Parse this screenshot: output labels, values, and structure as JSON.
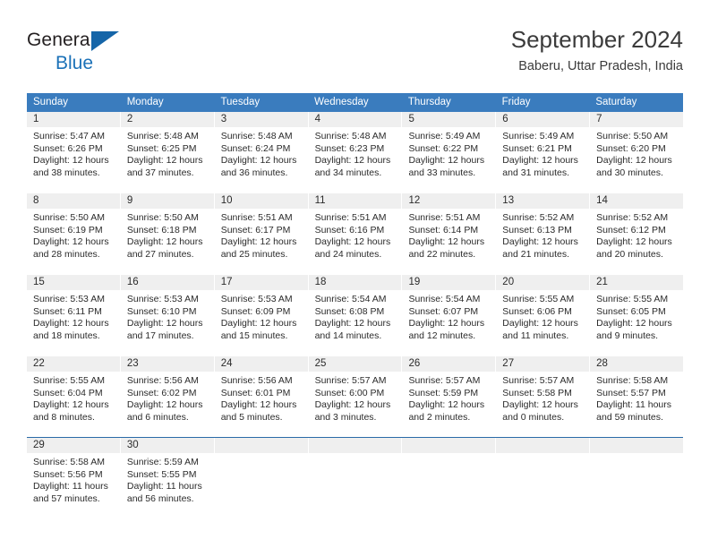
{
  "brand": {
    "line1": "General",
    "line2": "Blue",
    "flag_icon": "triangle-flag-icon",
    "colors": {
      "text": "#231f20",
      "blue": "#1c72b8",
      "flag": "#1565a8"
    }
  },
  "header": {
    "title": "September 2024",
    "subtitle": "Baberu, Uttar Pradesh, India"
  },
  "theme": {
    "header_blue": "#3a7cbe",
    "daynum_band": "#efefef",
    "cell_bg": "#ffffff",
    "rule_blue": "#2a6aa8"
  },
  "calendar": {
    "weekdays": [
      "Sunday",
      "Monday",
      "Tuesday",
      "Wednesday",
      "Thursday",
      "Friday",
      "Saturday"
    ],
    "weeks": [
      [
        {
          "day": "1",
          "sunrise": "Sunrise: 5:47 AM",
          "sunset": "Sunset: 6:26 PM",
          "daylight1": "Daylight: 12 hours",
          "daylight2": "and 38 minutes."
        },
        {
          "day": "2",
          "sunrise": "Sunrise: 5:48 AM",
          "sunset": "Sunset: 6:25 PM",
          "daylight1": "Daylight: 12 hours",
          "daylight2": "and 37 minutes."
        },
        {
          "day": "3",
          "sunrise": "Sunrise: 5:48 AM",
          "sunset": "Sunset: 6:24 PM",
          "daylight1": "Daylight: 12 hours",
          "daylight2": "and 36 minutes."
        },
        {
          "day": "4",
          "sunrise": "Sunrise: 5:48 AM",
          "sunset": "Sunset: 6:23 PM",
          "daylight1": "Daylight: 12 hours",
          "daylight2": "and 34 minutes."
        },
        {
          "day": "5",
          "sunrise": "Sunrise: 5:49 AM",
          "sunset": "Sunset: 6:22 PM",
          "daylight1": "Daylight: 12 hours",
          "daylight2": "and 33 minutes."
        },
        {
          "day": "6",
          "sunrise": "Sunrise: 5:49 AM",
          "sunset": "Sunset: 6:21 PM",
          "daylight1": "Daylight: 12 hours",
          "daylight2": "and 31 minutes."
        },
        {
          "day": "7",
          "sunrise": "Sunrise: 5:50 AM",
          "sunset": "Sunset: 6:20 PM",
          "daylight1": "Daylight: 12 hours",
          "daylight2": "and 30 minutes."
        }
      ],
      [
        {
          "day": "8",
          "sunrise": "Sunrise: 5:50 AM",
          "sunset": "Sunset: 6:19 PM",
          "daylight1": "Daylight: 12 hours",
          "daylight2": "and 28 minutes."
        },
        {
          "day": "9",
          "sunrise": "Sunrise: 5:50 AM",
          "sunset": "Sunset: 6:18 PM",
          "daylight1": "Daylight: 12 hours",
          "daylight2": "and 27 minutes."
        },
        {
          "day": "10",
          "sunrise": "Sunrise: 5:51 AM",
          "sunset": "Sunset: 6:17 PM",
          "daylight1": "Daylight: 12 hours",
          "daylight2": "and 25 minutes."
        },
        {
          "day": "11",
          "sunrise": "Sunrise: 5:51 AM",
          "sunset": "Sunset: 6:16 PM",
          "daylight1": "Daylight: 12 hours",
          "daylight2": "and 24 minutes."
        },
        {
          "day": "12",
          "sunrise": "Sunrise: 5:51 AM",
          "sunset": "Sunset: 6:14 PM",
          "daylight1": "Daylight: 12 hours",
          "daylight2": "and 22 minutes."
        },
        {
          "day": "13",
          "sunrise": "Sunrise: 5:52 AM",
          "sunset": "Sunset: 6:13 PM",
          "daylight1": "Daylight: 12 hours",
          "daylight2": "and 21 minutes."
        },
        {
          "day": "14",
          "sunrise": "Sunrise: 5:52 AM",
          "sunset": "Sunset: 6:12 PM",
          "daylight1": "Daylight: 12 hours",
          "daylight2": "and 20 minutes."
        }
      ],
      [
        {
          "day": "15",
          "sunrise": "Sunrise: 5:53 AM",
          "sunset": "Sunset: 6:11 PM",
          "daylight1": "Daylight: 12 hours",
          "daylight2": "and 18 minutes."
        },
        {
          "day": "16",
          "sunrise": "Sunrise: 5:53 AM",
          "sunset": "Sunset: 6:10 PM",
          "daylight1": "Daylight: 12 hours",
          "daylight2": "and 17 minutes."
        },
        {
          "day": "17",
          "sunrise": "Sunrise: 5:53 AM",
          "sunset": "Sunset: 6:09 PM",
          "daylight1": "Daylight: 12 hours",
          "daylight2": "and 15 minutes."
        },
        {
          "day": "18",
          "sunrise": "Sunrise: 5:54 AM",
          "sunset": "Sunset: 6:08 PM",
          "daylight1": "Daylight: 12 hours",
          "daylight2": "and 14 minutes."
        },
        {
          "day": "19",
          "sunrise": "Sunrise: 5:54 AM",
          "sunset": "Sunset: 6:07 PM",
          "daylight1": "Daylight: 12 hours",
          "daylight2": "and 12 minutes."
        },
        {
          "day": "20",
          "sunrise": "Sunrise: 5:55 AM",
          "sunset": "Sunset: 6:06 PM",
          "daylight1": "Daylight: 12 hours",
          "daylight2": "and 11 minutes."
        },
        {
          "day": "21",
          "sunrise": "Sunrise: 5:55 AM",
          "sunset": "Sunset: 6:05 PM",
          "daylight1": "Daylight: 12 hours",
          "daylight2": "and 9 minutes."
        }
      ],
      [
        {
          "day": "22",
          "sunrise": "Sunrise: 5:55 AM",
          "sunset": "Sunset: 6:04 PM",
          "daylight1": "Daylight: 12 hours",
          "daylight2": "and 8 minutes."
        },
        {
          "day": "23",
          "sunrise": "Sunrise: 5:56 AM",
          "sunset": "Sunset: 6:02 PM",
          "daylight1": "Daylight: 12 hours",
          "daylight2": "and 6 minutes."
        },
        {
          "day": "24",
          "sunrise": "Sunrise: 5:56 AM",
          "sunset": "Sunset: 6:01 PM",
          "daylight1": "Daylight: 12 hours",
          "daylight2": "and 5 minutes."
        },
        {
          "day": "25",
          "sunrise": "Sunrise: 5:57 AM",
          "sunset": "Sunset: 6:00 PM",
          "daylight1": "Daylight: 12 hours",
          "daylight2": "and 3 minutes."
        },
        {
          "day": "26",
          "sunrise": "Sunrise: 5:57 AM",
          "sunset": "Sunset: 5:59 PM",
          "daylight1": "Daylight: 12 hours",
          "daylight2": "and 2 minutes."
        },
        {
          "day": "27",
          "sunrise": "Sunrise: 5:57 AM",
          "sunset": "Sunset: 5:58 PM",
          "daylight1": "Daylight: 12 hours",
          "daylight2": "and 0 minutes."
        },
        {
          "day": "28",
          "sunrise": "Sunrise: 5:58 AM",
          "sunset": "Sunset: 5:57 PM",
          "daylight1": "Daylight: 11 hours",
          "daylight2": "and 59 minutes."
        }
      ],
      [
        {
          "day": "29",
          "sunrise": "Sunrise: 5:58 AM",
          "sunset": "Sunset: 5:56 PM",
          "daylight1": "Daylight: 11 hours",
          "daylight2": "and 57 minutes."
        },
        {
          "day": "30",
          "sunrise": "Sunrise: 5:59 AM",
          "sunset": "Sunset: 5:55 PM",
          "daylight1": "Daylight: 11 hours",
          "daylight2": "and 56 minutes."
        },
        {
          "day": "",
          "sunrise": "",
          "sunset": "",
          "daylight1": "",
          "daylight2": ""
        },
        {
          "day": "",
          "sunrise": "",
          "sunset": "",
          "daylight1": "",
          "daylight2": ""
        },
        {
          "day": "",
          "sunrise": "",
          "sunset": "",
          "daylight1": "",
          "daylight2": ""
        },
        {
          "day": "",
          "sunrise": "",
          "sunset": "",
          "daylight1": "",
          "daylight2": ""
        },
        {
          "day": "",
          "sunrise": "",
          "sunset": "",
          "daylight1": "",
          "daylight2": ""
        }
      ]
    ]
  }
}
